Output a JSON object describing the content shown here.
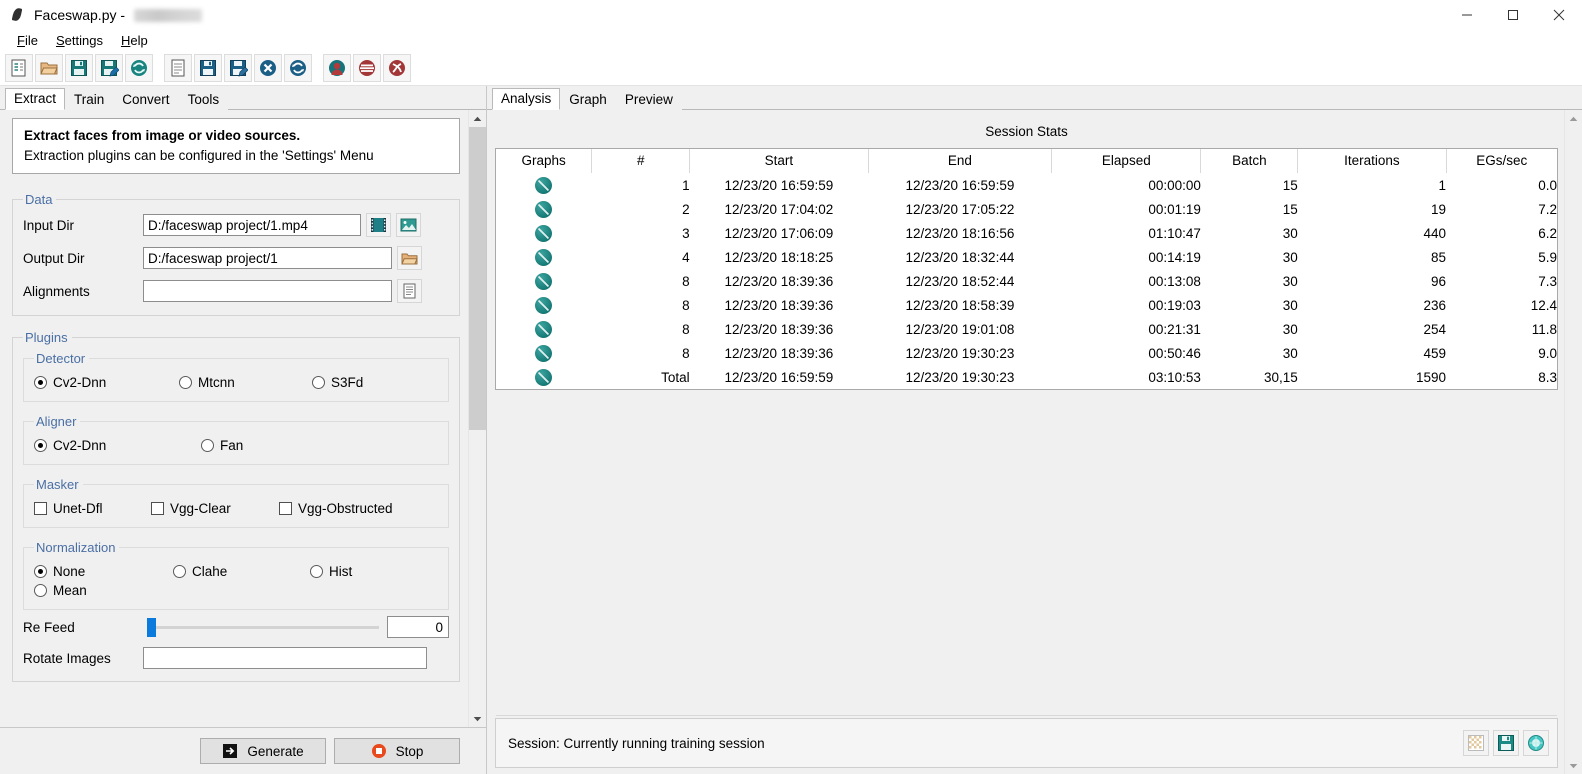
{
  "window": {
    "title": "Faceswap.py - ",
    "app_icon": "leaf-icon",
    "minimize": "minimize-icon",
    "maximize": "maximize-icon",
    "close": "close-icon"
  },
  "menubar": {
    "items": [
      {
        "label": "File",
        "mnemonic": "F"
      },
      {
        "label": "Settings",
        "mnemonic": "S"
      },
      {
        "label": "Help",
        "mnemonic": "H"
      }
    ]
  },
  "toolbar": {
    "buttons": [
      {
        "name": "new-project-icon",
        "title": "New Project"
      },
      {
        "name": "open-project-icon",
        "title": "Open Project"
      },
      {
        "name": "save-project-icon",
        "title": "Save Project"
      },
      {
        "name": "save-project-as-icon",
        "title": "Save Project As"
      },
      {
        "name": "reload-project-icon",
        "title": "Reload Project"
      },
      {
        "name": "new-task-icon",
        "title": "New Task"
      },
      {
        "name": "save-task-icon",
        "title": "Save Task"
      },
      {
        "name": "save-task-as-icon",
        "title": "Save Task As"
      },
      {
        "name": "clear-task-icon",
        "title": "Clear Task"
      },
      {
        "name": "reload-task-icon",
        "title": "Reload Task"
      },
      {
        "name": "extract-tool-icon",
        "title": "Extract"
      },
      {
        "name": "dataset-tool-icon",
        "title": "Dataset"
      },
      {
        "name": "effmpeg-tool-icon",
        "title": "Effmpeg"
      }
    ]
  },
  "left": {
    "tabs": [
      {
        "label": "Extract",
        "active": true
      },
      {
        "label": "Train",
        "active": false
      },
      {
        "label": "Convert",
        "active": false
      },
      {
        "label": "Tools",
        "active": false
      }
    ],
    "info": {
      "title": "Extract faces from image or video sources.",
      "subtitle": "Extraction plugins can be configured in the 'Settings' Menu"
    },
    "data_group": {
      "legend": "Data",
      "fields": [
        {
          "label": "Input Dir",
          "value": "D:/faceswap project/1.mp4",
          "placeholder": "",
          "buttons": [
            "film-icon",
            "image-icon"
          ]
        },
        {
          "label": "Output Dir",
          "value": "D:/faceswap project/1",
          "placeholder": "",
          "buttons": [
            "folder-icon"
          ]
        },
        {
          "label": "Alignments",
          "value": "",
          "placeholder": "",
          "buttons": [
            "file-icon"
          ]
        }
      ]
    },
    "plugins_group": {
      "legend": "Plugins",
      "sections": [
        {
          "legend": "Detector",
          "type": "radio",
          "options": [
            {
              "label": "Cv2-Dnn",
              "selected": true
            },
            {
              "label": "Mtcnn",
              "selected": false
            },
            {
              "label": "S3Fd",
              "selected": false
            }
          ]
        },
        {
          "legend": "Aligner",
          "type": "radio",
          "options": [
            {
              "label": "Cv2-Dnn",
              "selected": true
            },
            {
              "label": "Fan",
              "selected": false
            }
          ]
        },
        {
          "legend": "Masker",
          "type": "checkbox",
          "options": [
            {
              "label": "Unet-Dfl",
              "selected": false
            },
            {
              "label": "Vgg-Clear",
              "selected": false
            },
            {
              "label": "Vgg-Obstructed",
              "selected": false
            }
          ]
        },
        {
          "legend": "Normalization",
          "type": "radio",
          "options": [
            {
              "label": "None",
              "selected": true
            },
            {
              "label": "Clahe",
              "selected": false
            },
            {
              "label": "Hist",
              "selected": false
            },
            {
              "label": "Mean",
              "selected": false
            }
          ]
        }
      ]
    },
    "re_feed": {
      "label": "Re Feed",
      "value": "0",
      "slider_percent": 0
    },
    "rotate_images": {
      "label": "Rotate Images",
      "value": "",
      "placeholder": ""
    },
    "actions": [
      {
        "label": "Generate",
        "icon": "generate-icon"
      },
      {
        "label": "Stop",
        "icon": "stop-icon"
      }
    ]
  },
  "right": {
    "tabs": [
      {
        "label": "Analysis",
        "active": true
      },
      {
        "label": "Graph",
        "active": false
      },
      {
        "label": "Preview",
        "active": false
      }
    ],
    "section_title": "Session Stats",
    "table": {
      "columns": [
        "Graphs",
        "#",
        "Start",
        "End",
        "Elapsed",
        "Batch",
        "Iterations",
        "EGs/sec"
      ],
      "rows": [
        {
          "graph": "graph-icon",
          "num": "1",
          "start": "12/23/20 16:59:59",
          "end": "12/23/20 16:59:59",
          "elapsed": "00:00:00",
          "batch": "15",
          "iterations": "1",
          "egs": "0.0"
        },
        {
          "graph": "graph-icon",
          "num": "2",
          "start": "12/23/20 17:04:02",
          "end": "12/23/20 17:05:22",
          "elapsed": "00:01:19",
          "batch": "15",
          "iterations": "19",
          "egs": "7.2"
        },
        {
          "graph": "graph-icon",
          "num": "3",
          "start": "12/23/20 17:06:09",
          "end": "12/23/20 18:16:56",
          "elapsed": "01:10:47",
          "batch": "30",
          "iterations": "440",
          "egs": "6.2"
        },
        {
          "graph": "graph-icon",
          "num": "4",
          "start": "12/23/20 18:18:25",
          "end": "12/23/20 18:32:44",
          "elapsed": "00:14:19",
          "batch": "30",
          "iterations": "85",
          "egs": "5.9"
        },
        {
          "graph": "graph-icon",
          "num": "8",
          "start": "12/23/20 18:39:36",
          "end": "12/23/20 18:52:44",
          "elapsed": "00:13:08",
          "batch": "30",
          "iterations": "96",
          "egs": "7.3"
        },
        {
          "graph": "graph-icon",
          "num": "8",
          "start": "12/23/20 18:39:36",
          "end": "12/23/20 18:58:39",
          "elapsed": "00:19:03",
          "batch": "30",
          "iterations": "236",
          "egs": "12.4"
        },
        {
          "graph": "graph-icon",
          "num": "8",
          "start": "12/23/20 18:39:36",
          "end": "12/23/20 19:01:08",
          "elapsed": "00:21:31",
          "batch": "30",
          "iterations": "254",
          "egs": "11.8"
        },
        {
          "graph": "graph-icon",
          "num": "8",
          "start": "12/23/20 18:39:36",
          "end": "12/23/20 19:30:23",
          "elapsed": "00:50:46",
          "batch": "30",
          "iterations": "459",
          "egs": "9.0"
        },
        {
          "graph": "graph-icon",
          "num": "Total",
          "start": "12/23/20 16:59:59",
          "end": "12/23/20 19:30:23",
          "elapsed": "03:10:53",
          "batch": "30,15",
          "iterations": "1590",
          "egs": "8.3"
        }
      ]
    },
    "status": {
      "text": "Session: Currently running training session",
      "buttons": [
        {
          "name": "clear-icon",
          "title": "Clear"
        },
        {
          "name": "save-icon",
          "title": "Save"
        },
        {
          "name": "refresh-icon",
          "title": "Refresh"
        }
      ]
    }
  },
  "colors": {
    "accent_blue": "#4a6fa5",
    "slider_blue": "#0a7bdc",
    "teal": "#177a77",
    "stop_red": "#e8491d"
  }
}
